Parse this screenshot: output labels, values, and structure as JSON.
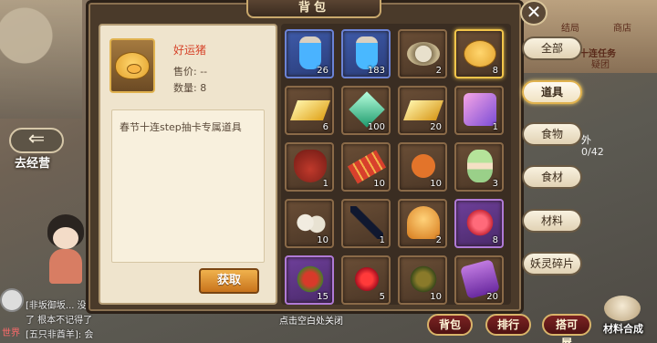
{
  "panel": {
    "title": "背包",
    "close_symbol": "✕"
  },
  "detail": {
    "name": "好运猪",
    "price": "售价: --",
    "quantity": "数量: 8",
    "description": "春节十连step抽卡专属道具",
    "get_button": "获取"
  },
  "grid": [
    {
      "icon": "blue-potion-icon",
      "count": "26",
      "rarity": "blue"
    },
    {
      "icon": "purple-potion-icon",
      "count": "183",
      "rarity": "blue"
    },
    {
      "icon": "silver-plate-icon",
      "count": "2",
      "rarity": "normal"
    },
    {
      "icon": "lucky-pig-icon",
      "count": "8",
      "rarity": "selected"
    },
    {
      "icon": "gold-bar-icon",
      "count": "6",
      "rarity": "normal"
    },
    {
      "icon": "green-crystal-icon",
      "count": "100",
      "rarity": "normal"
    },
    {
      "icon": "gold-ingot-icon",
      "count": "20",
      "rarity": "normal"
    },
    {
      "icon": "sr-card-icon",
      "count": "1",
      "rarity": "normal"
    },
    {
      "icon": "lantern-bag-icon",
      "count": "1",
      "rarity": "normal"
    },
    {
      "icon": "firecracker-icon",
      "count": "10",
      "rarity": "normal"
    },
    {
      "icon": "crab-icon",
      "count": "10",
      "rarity": "normal"
    },
    {
      "icon": "doll-icon",
      "count": "3",
      "rarity": "normal"
    },
    {
      "icon": "dumpling-icon",
      "count": "10",
      "rarity": "normal"
    },
    {
      "icon": "black-feather-icon",
      "count": "1",
      "rarity": "normal"
    },
    {
      "icon": "bell-icon",
      "count": "2",
      "rarity": "normal"
    },
    {
      "icon": "red-flower-icon",
      "count": "8",
      "rarity": "purple"
    },
    {
      "icon": "red-berries-icon",
      "count": "15",
      "rarity": "purple"
    },
    {
      "icon": "red-spider-lily-icon",
      "count": "5",
      "rarity": "normal"
    },
    {
      "icon": "scarab-icon",
      "count": "10",
      "rarity": "normal"
    },
    {
      "icon": "purple-scroll-icon",
      "count": "20",
      "rarity": "normal"
    }
  ],
  "tabs": [
    {
      "label": "全部",
      "active": false
    },
    {
      "label": "道具",
      "active": true
    },
    {
      "label": "食物",
      "active": false
    },
    {
      "label": "食材",
      "active": false
    },
    {
      "label": "材料",
      "active": false
    },
    {
      "label": "妖灵碎片",
      "active": false
    }
  ],
  "background": {
    "back_label": "去经营",
    "right_signs": [
      "结局",
      "商店",
      "十连任务",
      "疑团",
      "外",
      "0/42"
    ],
    "chat": [
      "[非坂御坂... 没",
      "了 根本不记得了",
      "[五只非酋羊]: 会"
    ],
    "world_tag": "世界"
  },
  "bottom": {
    "hint": "点击空白处关闭",
    "buttons": [
      "背包",
      "排行",
      "搭可屋"
    ],
    "material_label": "材料合成"
  }
}
